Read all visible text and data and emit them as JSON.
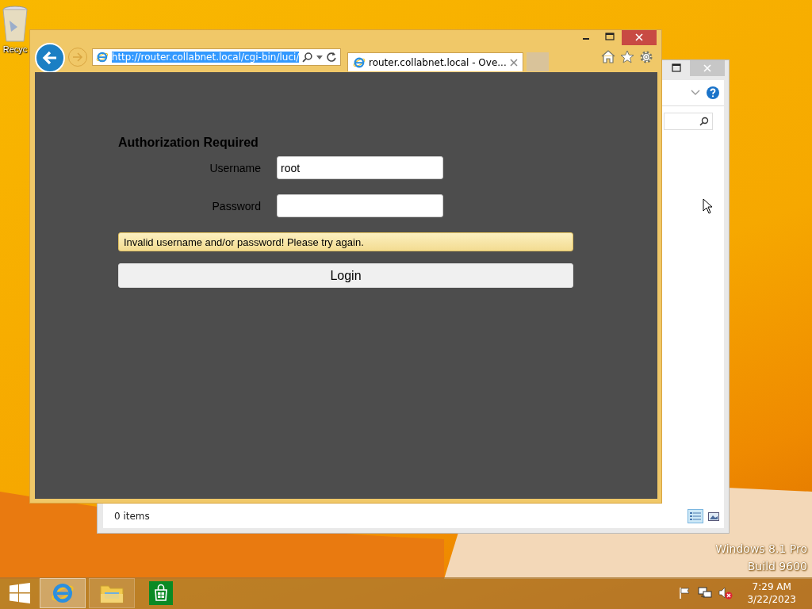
{
  "desktop": {
    "icons": [
      {
        "label": "Recyc"
      }
    ],
    "edition": [
      "Windows 8.1 Pro",
      "Build 9600"
    ]
  },
  "explorer_window": {
    "status": "0 items",
    "views": [
      {
        "kind": "details",
        "selected": true
      },
      {
        "kind": "large",
        "selected": false
      }
    ]
  },
  "browser": {
    "address": "http://router.collabnet.local/cgi-bin/luci/",
    "address_selected": true,
    "tabs": [
      {
        "label": "router.collabnet.local - Ove...",
        "selected": true
      }
    ],
    "page": {
      "heading": "Authorization Required",
      "fields": [
        {
          "label": "Username",
          "value": "root"
        },
        {
          "label": "Password"
        }
      ],
      "error": "Invalid username and/or password! Please try again.",
      "button": "Login"
    }
  },
  "taskbar": {
    "apps": [
      {
        "kind": "browser",
        "selected": true
      },
      {
        "kind": "files",
        "selected": false
      },
      {
        "kind": "store",
        "selected": false
      }
    ],
    "time": "7:29 AM",
    "date": "3/22/2023"
  }
}
